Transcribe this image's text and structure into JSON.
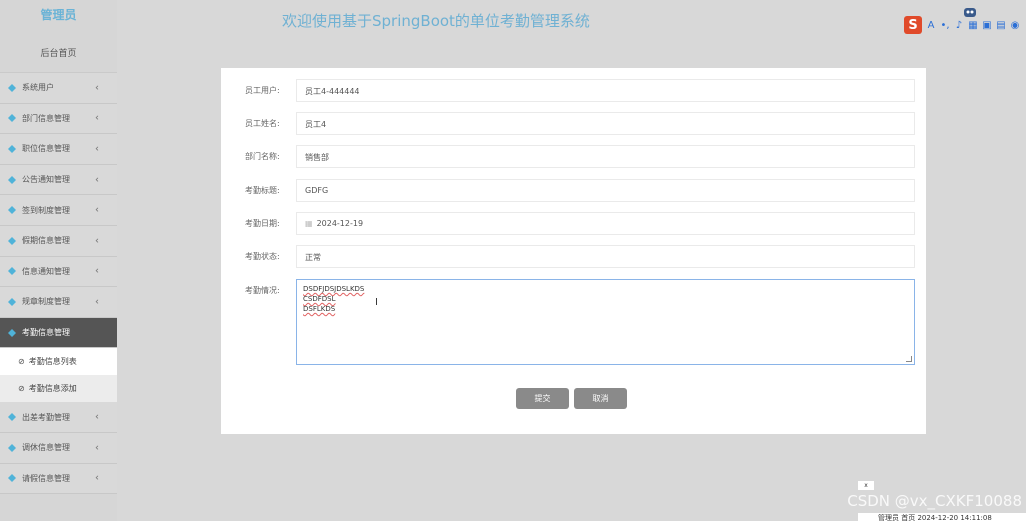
{
  "sidebar": {
    "header": "管理员",
    "home": "后台首页",
    "items": [
      {
        "label": "系统用户"
      },
      {
        "label": "部门信息管理"
      },
      {
        "label": "职位信息管理"
      },
      {
        "label": "公告通知管理"
      },
      {
        "label": "签到制度管理"
      },
      {
        "label": "假期信息管理"
      },
      {
        "label": "信息通知管理"
      },
      {
        "label": "规章制度管理"
      },
      {
        "label": "考勤信息管理"
      }
    ],
    "sub_items": [
      {
        "label": "考勤信息列表"
      },
      {
        "label": "考勤信息添加"
      }
    ],
    "items_after": [
      {
        "label": "出差考勤管理"
      },
      {
        "label": "调休信息管理"
      },
      {
        "label": "请假信息管理"
      }
    ]
  },
  "header": {
    "title": "欢迎使用基于SpringBoot的单位考勤管理系统"
  },
  "form": {
    "fields": [
      {
        "label": "员工用户:",
        "value": "员工4-444444"
      },
      {
        "label": "员工姓名:",
        "value": "员工4"
      },
      {
        "label": "部门名称:",
        "value": "销售部"
      },
      {
        "label": "考勤标题:",
        "value": "GDFG"
      },
      {
        "label": "考勤日期:",
        "value": "2024-12-19"
      },
      {
        "label": "考勤状态:",
        "value": "正常"
      }
    ],
    "situation_label": "考勤情况:",
    "situation_lines": [
      "DSDFJDSJDSLKDS",
      "CSDFDSL",
      "DSFLKDS"
    ],
    "submit": "提交",
    "cancel": "取消"
  },
  "overlay": {
    "watermark": "CSDN @vx_CXKF10088",
    "status": "管理员  首页  2024-12-20 14:11:08",
    "close": "x"
  },
  "colors": {
    "accent": "#6fb1d3",
    "active_menu": "#555555",
    "button": "#8a8a8a"
  }
}
